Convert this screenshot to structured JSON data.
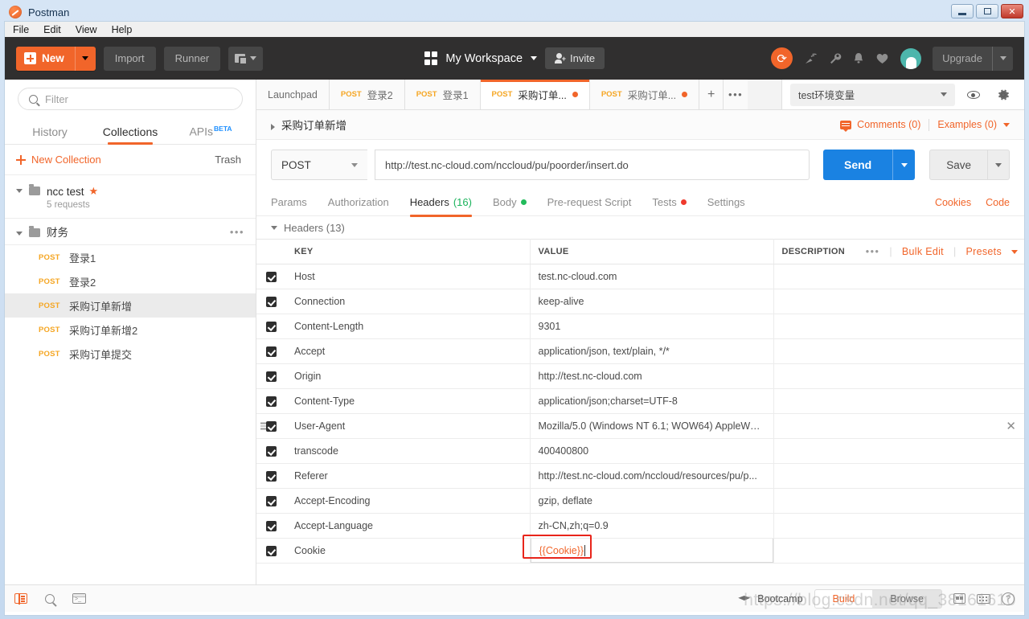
{
  "window": {
    "title": "Postman",
    "icon": "postman-logo-icon",
    "minimize": "–",
    "maximize": "❐",
    "close": "✕"
  },
  "menubar": {
    "items": [
      "File",
      "Edit",
      "View",
      "Help"
    ]
  },
  "toolbar": {
    "new_label": "New",
    "import_label": "Import",
    "runner_label": "Runner",
    "workspace_label": "My Workspace",
    "invite_label": "Invite",
    "upgrade_label": "Upgrade",
    "sync_icon": "sync-icon",
    "broadcast_icon": "broadcast-icon",
    "wrench_icon": "wrench-icon",
    "bell_icon": "bell-icon",
    "heart_icon": "heart-icon",
    "avatar_icon": "avatar-icon"
  },
  "sidebar": {
    "filter_placeholder": "Filter",
    "tabs": [
      {
        "label": "History",
        "active": false
      },
      {
        "label": "Collections",
        "active": true
      },
      {
        "label": "APIs",
        "active": false,
        "badge": "BETA"
      }
    ],
    "new_collection": "New Collection",
    "trash": "Trash",
    "collection": {
      "name": "ncc test",
      "subtitle": "5 requests",
      "starred": true
    },
    "folder": {
      "name": "财务"
    },
    "requests": [
      {
        "method": "POST",
        "name": "登录1",
        "selected": false
      },
      {
        "method": "POST",
        "name": "登录2",
        "selected": false
      },
      {
        "method": "POST",
        "name": "采购订单新增",
        "selected": true
      },
      {
        "method": "POST",
        "name": "采购订单新增2",
        "selected": false
      },
      {
        "method": "POST",
        "name": "采购订单提交",
        "selected": false
      }
    ]
  },
  "tabstrip": {
    "tabs": [
      {
        "label": "Launchpad",
        "method": "",
        "active": false,
        "unsaved": false
      },
      {
        "label": "登录2",
        "method": "POST",
        "active": false,
        "unsaved": false
      },
      {
        "label": "登录1",
        "method": "POST",
        "active": false,
        "unsaved": false
      },
      {
        "label": "采购订单...",
        "method": "POST",
        "active": true,
        "unsaved": true
      },
      {
        "label": "采购订单...",
        "method": "POST",
        "active": false,
        "unsaved": true
      }
    ],
    "add_label": "+",
    "more_label": "•••",
    "environment": "test环境变量",
    "eye_icon": "eye-icon",
    "gear_icon": "gear-icon"
  },
  "request": {
    "title": "采购订单新增",
    "comments_label": "Comments (0)",
    "examples_label": "Examples (0)",
    "method": "POST",
    "url": "http://test.nc-cloud.com/nccloud/pu/poorder/insert.do",
    "send_label": "Send",
    "save_label": "Save",
    "tabs": [
      {
        "label": "Params",
        "active": false,
        "count": "",
        "dot": ""
      },
      {
        "label": "Authorization",
        "active": false,
        "count": "",
        "dot": ""
      },
      {
        "label": "Headers",
        "active": true,
        "count": "(16)",
        "dot": ""
      },
      {
        "label": "Body",
        "active": false,
        "count": "",
        "dot": "green"
      },
      {
        "label": "Pre-request Script",
        "active": false,
        "count": "",
        "dot": ""
      },
      {
        "label": "Tests",
        "active": false,
        "count": "",
        "dot": "red"
      },
      {
        "label": "Settings",
        "active": false,
        "count": "",
        "dot": ""
      }
    ],
    "cookies_label": "Cookies",
    "code_label": "Code"
  },
  "headers_section": {
    "collapse_label": "Headers (13)",
    "columns": [
      "KEY",
      "VALUE",
      "DESCRIPTION"
    ],
    "bulk_edit_label": "Bulk Edit",
    "presets_label": "Presets",
    "more_dots": "•••",
    "rows": [
      {
        "checked": true,
        "key": "Host",
        "value": "test.nc-cloud.com",
        "description": ""
      },
      {
        "checked": true,
        "key": "Connection",
        "value": "keep-alive",
        "description": ""
      },
      {
        "checked": true,
        "key": "Content-Length",
        "value": "9301",
        "description": ""
      },
      {
        "checked": true,
        "key": "Accept",
        "value": "application/json, text/plain, */*",
        "description": ""
      },
      {
        "checked": true,
        "key": "Origin",
        "value": "http://test.nc-cloud.com",
        "description": ""
      },
      {
        "checked": true,
        "key": "Content-Type",
        "value": "application/json;charset=UTF-8",
        "description": ""
      },
      {
        "checked": true,
        "key": "User-Agent",
        "value": "Mozilla/5.0 (Windows NT 6.1; WOW64) AppleWeb...",
        "description": "",
        "hovered": true
      },
      {
        "checked": true,
        "key": "transcode",
        "value": "400400800",
        "description": ""
      },
      {
        "checked": true,
        "key": "Referer",
        "value": "http://test.nc-cloud.com/nccloud/resources/pu/p...",
        "description": ""
      },
      {
        "checked": true,
        "key": "Accept-Encoding",
        "value": "gzip, deflate",
        "description": ""
      },
      {
        "checked": true,
        "key": "Accept-Language",
        "value": "zh-CN,zh;q=0.9",
        "description": ""
      },
      {
        "checked": true,
        "key": "Cookie",
        "value": "{{Cookie}}",
        "description": "",
        "focused": true,
        "highlighted": true
      }
    ]
  },
  "statusbar": {
    "console_icon": "console-icon",
    "search_icon": "search-icon",
    "terminal_icon": "terminal-icon",
    "bootcamp_label": "Bootcamp",
    "build_label": "Build",
    "browse_label": "Browse",
    "trash_icon": "two-pane-icon",
    "keyboard_icon": "keyboard-icon",
    "help_icon": "help-icon",
    "watermark": "https://blog.csdn.net/qq_38161610"
  },
  "colors": {
    "accent": "#f1652a",
    "send": "#1a82e2",
    "verb": "#f5a623",
    "green": "#22bb5b",
    "red": "#ef3a2d",
    "annotation": "#e8251b"
  }
}
